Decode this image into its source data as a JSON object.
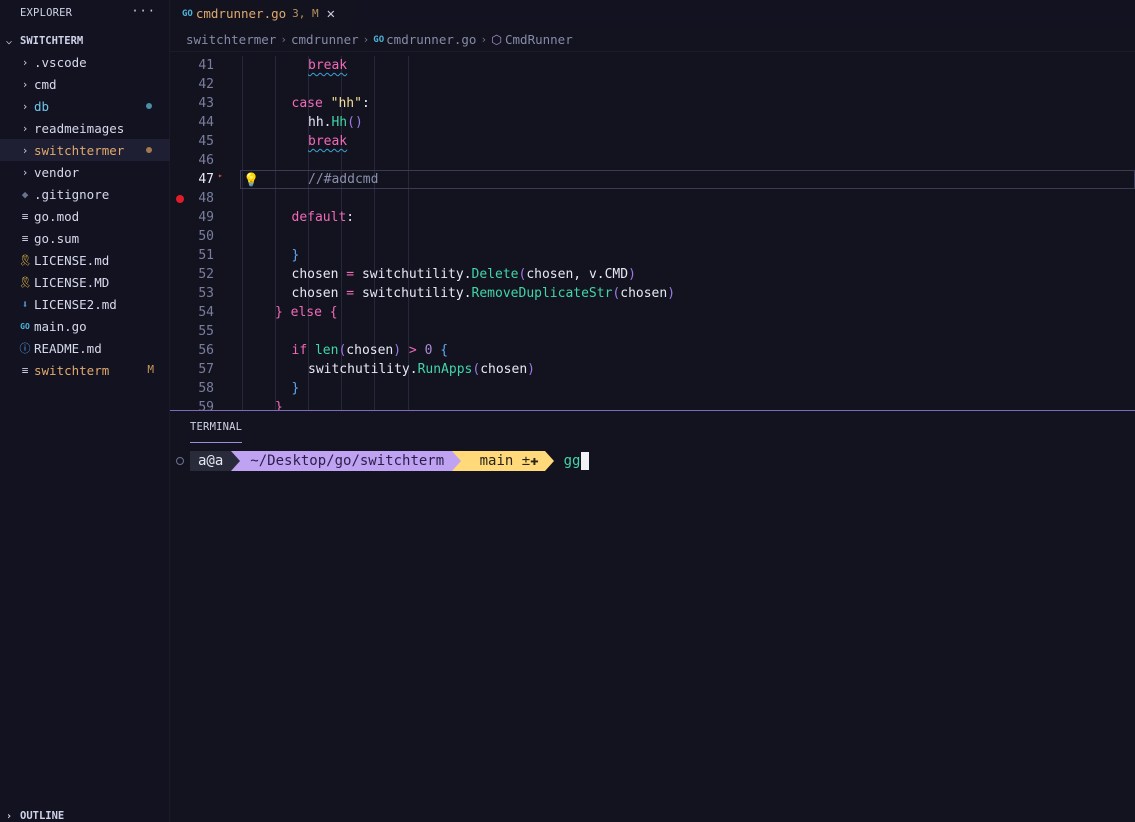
{
  "sidebar": {
    "title": "EXPLORER",
    "more_label": "···",
    "root": "SWITCHTERM",
    "items": [
      {
        "label": ".vscode",
        "icon": "chevron-right-icon",
        "color": "#d6d9ec",
        "dot": null,
        "badge": ""
      },
      {
        "label": "cmd",
        "icon": "chevron-right-icon",
        "color": "#d6d9ec",
        "dot": null,
        "badge": ""
      },
      {
        "label": "db",
        "icon": "chevron-right-icon",
        "color": "#6fc6e8",
        "dot": "#4a8fa8",
        "badge": ""
      },
      {
        "label": "readmeimages",
        "icon": "chevron-right-icon",
        "color": "#d6d9ec",
        "dot": null,
        "badge": ""
      },
      {
        "label": "switchtermer",
        "icon": "chevron-right-icon",
        "color": "#e0a96d",
        "dot": "#a07a4e",
        "badge": "",
        "selected": true
      },
      {
        "label": "vendor",
        "icon": "chevron-right-icon",
        "color": "#d6d9ec",
        "dot": null,
        "badge": ""
      },
      {
        "label": ".gitignore",
        "icon": "git-diamond-icon",
        "color": "#d6d9ec",
        "dot": null,
        "badge": ""
      },
      {
        "label": "go.mod",
        "icon": "lines-file-icon",
        "color": "#d6d9ec",
        "dot": null,
        "badge": ""
      },
      {
        "label": "go.sum",
        "icon": "lines-file-icon",
        "color": "#d6d9ec",
        "dot": null,
        "badge": ""
      },
      {
        "label": "LICENSE.md",
        "icon": "license-ribbon-icon",
        "color": "#d6d9ec",
        "dot": null,
        "badge": ""
      },
      {
        "label": "LICENSE.MD",
        "icon": "license-ribbon-icon",
        "color": "#d6d9ec",
        "dot": null,
        "badge": ""
      },
      {
        "label": "LICENSE2.md",
        "icon": "markdown-arrow-icon",
        "color": "#d6d9ec",
        "dot": null,
        "badge": ""
      },
      {
        "label": "main.go",
        "icon": "go-file-icon",
        "color": "#d6d9ec",
        "dot": null,
        "badge": ""
      },
      {
        "label": "README.md",
        "icon": "info-circle-icon",
        "color": "#d6d9ec",
        "dot": null,
        "badge": ""
      },
      {
        "label": "switchterm",
        "icon": "lines-file-icon",
        "color": "#e0a96d",
        "dot": null,
        "badge": "M"
      }
    ],
    "outline": "OUTLINE"
  },
  "tab": {
    "file_icon": "GO",
    "name": "cmdrunner.go",
    "meta": "3, M",
    "close": "✕"
  },
  "breadcrumb": {
    "parts": [
      "switchtermer",
      "cmdrunner",
      "cmdrunner.go",
      "CmdRunner"
    ],
    "go_icon": "GO"
  },
  "editor": {
    "active_line": 47,
    "breakpoint_line": 48,
    "lines": [
      {
        "n": "41",
        "indent": 8,
        "tokens": [
          [
            "kw squig",
            "break"
          ]
        ]
      },
      {
        "n": "42",
        "indent": 0,
        "tokens": []
      },
      {
        "n": "43",
        "indent": 6,
        "tokens": [
          [
            "kw",
            "case "
          ],
          [
            "str",
            "\"hh\""
          ],
          [
            "pl",
            ":"
          ]
        ]
      },
      {
        "n": "44",
        "indent": 8,
        "tokens": [
          [
            "pl",
            "hh."
          ],
          [
            "fn",
            "Hh"
          ],
          [
            "par",
            "()"
          ]
        ]
      },
      {
        "n": "45",
        "indent": 8,
        "tokens": [
          [
            "kw squig",
            "break"
          ]
        ]
      },
      {
        "n": "46",
        "indent": 0,
        "tokens": []
      },
      {
        "n": "47",
        "indent": 8,
        "tokens": [
          [
            "cmt",
            "//#addcmd"
          ]
        ]
      },
      {
        "n": "48",
        "indent": 0,
        "tokens": []
      },
      {
        "n": "49",
        "indent": 6,
        "tokens": [
          [
            "kw",
            "default"
          ],
          [
            "pl",
            ":"
          ]
        ]
      },
      {
        "n": "50",
        "indent": 0,
        "tokens": []
      },
      {
        "n": "51",
        "indent": 6,
        "tokens": [
          [
            "br",
            "}"
          ]
        ]
      },
      {
        "n": "52",
        "indent": 6,
        "tokens": [
          [
            "pl",
            "chosen "
          ],
          [
            "op",
            "="
          ],
          [
            "pl",
            " switchutility."
          ],
          [
            "fn",
            "Delete"
          ],
          [
            "par",
            "("
          ],
          [
            "pl",
            "chosen, v.CMD"
          ],
          [
            "par",
            ")"
          ]
        ]
      },
      {
        "n": "53",
        "indent": 6,
        "tokens": [
          [
            "pl",
            "chosen "
          ],
          [
            "op",
            "="
          ],
          [
            "pl",
            " switchutility."
          ],
          [
            "fn",
            "RemoveDuplicateStr"
          ],
          [
            "par",
            "("
          ],
          [
            "pl",
            "chosen"
          ],
          [
            "par",
            ")"
          ]
        ]
      },
      {
        "n": "54",
        "indent": 4,
        "tokens": [
          [
            "kw",
            "} else {"
          ]
        ]
      },
      {
        "n": "55",
        "indent": 0,
        "tokens": []
      },
      {
        "n": "56",
        "indent": 6,
        "tokens": [
          [
            "kw",
            "if "
          ],
          [
            "fn",
            "len"
          ],
          [
            "par",
            "("
          ],
          [
            "pl",
            "chosen"
          ],
          [
            "par",
            ")"
          ],
          [
            "pl",
            " "
          ],
          [
            "op",
            ">"
          ],
          [
            "pl",
            " "
          ],
          [
            "num",
            "0"
          ],
          [
            "pl",
            " "
          ],
          [
            "br",
            "{"
          ]
        ]
      },
      {
        "n": "57",
        "indent": 8,
        "tokens": [
          [
            "pl",
            "switchutility."
          ],
          [
            "fn",
            "RunApps"
          ],
          [
            "par",
            "("
          ],
          [
            "pl",
            "chosen"
          ],
          [
            "par",
            ")"
          ]
        ]
      },
      {
        "n": "58",
        "indent": 6,
        "tokens": [
          [
            "br",
            "}"
          ]
        ]
      },
      {
        "n": "59",
        "indent": 4,
        "tokens": [
          [
            "kw",
            "}"
          ]
        ]
      }
    ]
  },
  "terminal": {
    "tab_label": "TERMINAL",
    "user": "a@a",
    "path": "~/Desktop/go/switchterm",
    "branch_icon": "",
    "branch": "main",
    "git_status": "±✚",
    "command": "gg"
  },
  "colors": {
    "accent": "#9b8ee0",
    "path_segment": "#bfa3f2",
    "git_segment": "#ffd97a",
    "modified": "#e0a96d"
  }
}
